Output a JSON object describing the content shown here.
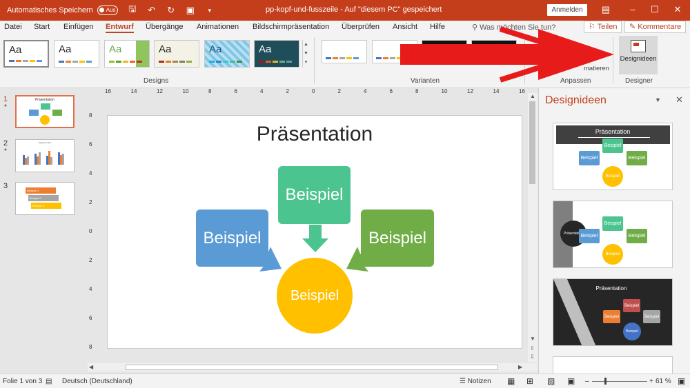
{
  "titlebar": {
    "autosave_label": "Automatisches Speichern",
    "autosave_state": "Aus",
    "doc_title": "pp-kopf-und-fusszeile  -  Auf \"diesem PC\" gespeichert",
    "signin_label": "Anmelden"
  },
  "tabs": [
    "Datei",
    "Start",
    "Einfügen",
    "Entwurf",
    "Übergänge",
    "Animationen",
    "Bildschirmpräsentation",
    "Überprüfen",
    "Ansicht",
    "Hilfe"
  ],
  "active_tab": "Entwurf",
  "tell_me": "Was möchten Sie tun?",
  "share_label": "Teilen",
  "comments_label": "Kommentare",
  "ribbon": {
    "designs_label": "Designs",
    "variants_label": "Varianten",
    "customize_label": "Anpassen",
    "designer_label": "Designer",
    "design_ideas_label": "Designideen",
    "format_partial": "matieren",
    "theme_sample_text": "Aa"
  },
  "thumbnails": [
    {
      "number": "1",
      "star": "*",
      "title": "Präsentation",
      "label": "Beispiel"
    },
    {
      "number": "2",
      "star": "*",
      "title": "Diagrammtitel"
    },
    {
      "number": "3",
      "items": [
        "Beispiel 1",
        "Beispiel 2",
        "Beispiel 3"
      ]
    }
  ],
  "ruler": {
    "h_labels": [
      "16",
      "14",
      "12",
      "10",
      "8",
      "6",
      "4",
      "2",
      "0",
      "2",
      "4",
      "6",
      "8",
      "10",
      "12",
      "14",
      "16"
    ],
    "v_labels": [
      "8",
      "6",
      "4",
      "2",
      "0",
      "2",
      "4",
      "6",
      "8"
    ]
  },
  "slide": {
    "title": "Präsentation",
    "boxes": [
      "Beispiel",
      "Beispiel",
      "Beispiel",
      "Beispiel"
    ]
  },
  "designer": {
    "title": "Designideen",
    "idea1_title": "Präsentation",
    "idea2_circle": "Präsentation",
    "idea3_title": "Präsentation",
    "box_label": "Beispiel"
  },
  "status": {
    "slide_count": "Folie 1 von 3",
    "language": "Deutsch (Deutschland)",
    "notes": "Notizen",
    "zoom": "61 %"
  },
  "colors": {
    "accent": "#c43e1c",
    "blue": "#5b9bd5",
    "green_top": "#4cc48f",
    "green_right": "#70ad47",
    "yellow": "#ffc000",
    "arrow": "#e81b1b"
  }
}
